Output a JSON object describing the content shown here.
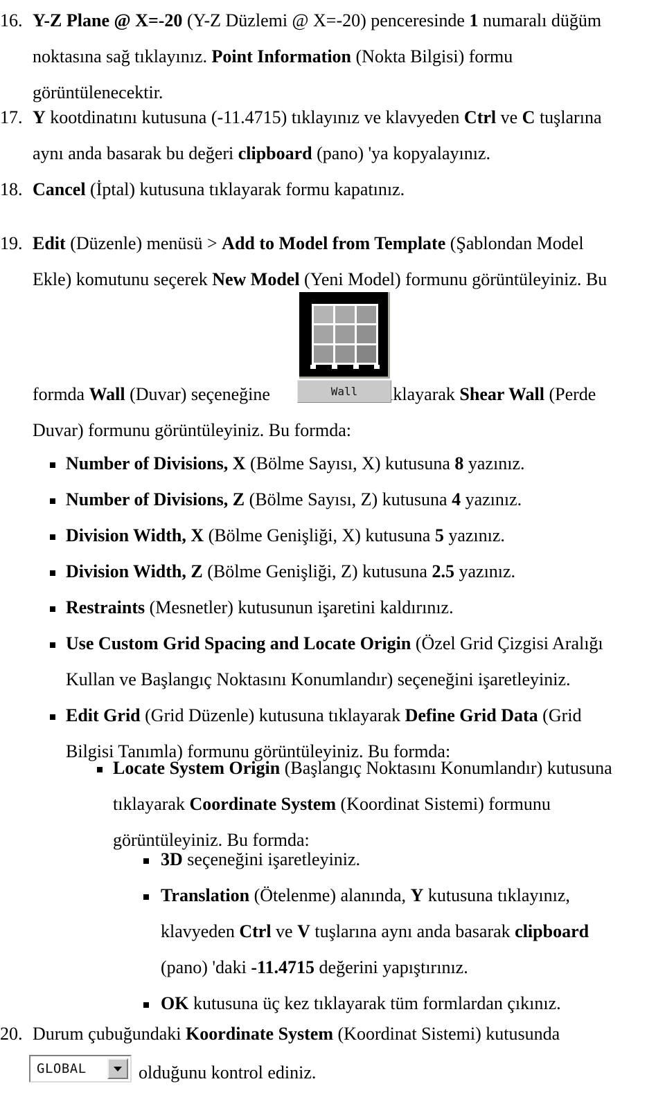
{
  "document": {
    "language": "Turkish",
    "steps": [
      {
        "number": "16.",
        "lines": [
          [
            {
              "t": "Y-Z Plane @ X=-20",
              "b": true
            },
            {
              "t": " (Y-Z Düzlemi @ X=-20) penceresinde ",
              "b": false
            },
            {
              "t": "1",
              "b": true
            },
            {
              "t": " numaralı düğüm",
              "b": false
            }
          ],
          [
            {
              "t": "noktasına sağ tıklayınız. ",
              "b": false
            },
            {
              "t": "Point Information",
              "b": true
            },
            {
              "t": " (Nokta Bilgisi) formu",
              "b": false
            }
          ],
          [
            {
              "t": "görüntülenecektir.",
              "b": false
            }
          ]
        ]
      },
      {
        "number": "17.",
        "lines": [
          [
            {
              "t": "Y",
              "b": true
            },
            {
              "t": " kootdinatını kutusuna (-11.4715) tıklayınız ve klavyeden ",
              "b": false
            },
            {
              "t": "Ctrl",
              "b": true
            },
            {
              "t": " ve ",
              "b": false
            },
            {
              "t": "C",
              "b": true
            },
            {
              "t": " tuşlarına",
              "b": false
            }
          ],
          [
            {
              "t": "aynı anda basarak bu değeri ",
              "b": false
            },
            {
              "t": "clipboard",
              "b": true
            },
            {
              "t": " (pano) 'ya kopyalayınız.",
              "b": false
            }
          ]
        ]
      },
      {
        "number": "18.",
        "lines": [
          [
            {
              "t": "Cancel",
              "b": true
            },
            {
              "t": " (İptal) kutusuna tıklayarak formu kapatınız.",
              "b": false
            }
          ]
        ]
      },
      {
        "number": "19.",
        "lines": [
          [
            {
              "t": "Edit",
              "b": true
            },
            {
              "t": " (Düzenle) menüsü > ",
              "b": false
            },
            {
              "t": "Add to Model from Template",
              "b": true
            },
            {
              "t": " (Şablondan Model",
              "b": false
            }
          ],
          [
            {
              "t": "Ekle) komutunu seçerek ",
              "b": false
            },
            {
              "t": "New Model",
              "b": true
            },
            {
              "t": " (Yeni Model) formunu görüntüleyiniz. Bu",
              "b": false
            }
          ]
        ]
      },
      {
        "number": "20.",
        "lines": [
          [
            {
              "t": "Durum çubuğundaki ",
              "b": false
            },
            {
              "t": "Koordinate System",
              "b": true
            },
            {
              "t": " (Koordinat Sistemi) kutusunda",
              "b": false
            }
          ]
        ]
      }
    ],
    "wall_para": {
      "before": [
        {
          "t": "formda ",
          "b": false
        },
        {
          "t": "Wall",
          "b": true
        },
        {
          "t": " (Duvar) seçeneğine",
          "b": false
        }
      ],
      "after": [
        {
          "t": "tıklayarak ",
          "b": false
        },
        {
          "t": "Shear Wall",
          "b": true
        },
        {
          "t": " (Perde",
          "b": false
        }
      ],
      "line2": [
        {
          "t": "Duvar) formunu görüntüleyiniz. Bu formda:",
          "b": false
        }
      ]
    },
    "bullets_level1": [
      {
        "lines": [
          [
            {
              "t": "Number of Divisions, X",
              "b": true
            },
            {
              "t": " (Bölme Sayısı, X) kutusuna ",
              "b": false
            },
            {
              "t": "8",
              "b": true
            },
            {
              "t": " yazınız.",
              "b": false
            }
          ]
        ]
      },
      {
        "lines": [
          [
            {
              "t": "Number of Divisions, Z",
              "b": true
            },
            {
              "t": " (Bölme Sayısı, Z) kutusuna ",
              "b": false
            },
            {
              "t": "4",
              "b": true
            },
            {
              "t": " yazınız.",
              "b": false
            }
          ]
        ]
      },
      {
        "lines": [
          [
            {
              "t": "Division Width, X",
              "b": true
            },
            {
              "t": " (Bölme Genişliği, X) kutusuna ",
              "b": false
            },
            {
              "t": "5",
              "b": true
            },
            {
              "t": " yazınız.",
              "b": false
            }
          ]
        ]
      },
      {
        "lines": [
          [
            {
              "t": "Division Width, Z",
              "b": true
            },
            {
              "t": " (Bölme Genişliği, Z) kutusuna ",
              "b": false
            },
            {
              "t": "2.5",
              "b": true
            },
            {
              "t": " yazınız.",
              "b": false
            }
          ]
        ]
      },
      {
        "lines": [
          [
            {
              "t": "Restraints",
              "b": true
            },
            {
              "t": " (Mesnetler) kutusunun işaretini kaldırınız.",
              "b": false
            }
          ]
        ]
      },
      {
        "lines": [
          [
            {
              "t": "Use Custom Grid Spacing and Locate Origin",
              "b": true
            },
            {
              "t": " (Özel Grid Çizgisi Aralığı",
              "b": false
            }
          ],
          [
            {
              "t": "Kullan ve Başlangıç Noktasını Konumlandır) seçeneğini işaretleyiniz.",
              "b": false
            }
          ]
        ]
      },
      {
        "lines": [
          [
            {
              "t": "Edit Grid",
              "b": true
            },
            {
              "t": " (Grid Düzenle) kutusuna tıklayarak ",
              "b": false
            },
            {
              "t": "Define Grid Data",
              "b": true
            },
            {
              "t": " (Grid",
              "b": false
            }
          ],
          [
            {
              "t": "Bilgisi Tanımla) formunu görüntüleyiniz. Bu formda:",
              "b": false
            }
          ]
        ]
      }
    ],
    "bullets_level2": [
      {
        "lines": [
          [
            {
              "t": "Locate System Origin",
              "b": true
            },
            {
              "t": " (Başlangıç Noktasını Konumlandır) kutusuna",
              "b": false
            }
          ],
          [
            {
              "t": "tıklayarak ",
              "b": false
            },
            {
              "t": "Coordinate System",
              "b": true
            },
            {
              "t": " (Koordinat Sistemi) formunu",
              "b": false
            }
          ],
          [
            {
              "t": "görüntüleyiniz. Bu formda:",
              "b": false
            }
          ]
        ]
      }
    ],
    "bullets_level3": [
      {
        "lines": [
          [
            {
              "t": "3D",
              "b": true
            },
            {
              "t": " seçeneğini işaretleyiniz.",
              "b": false
            }
          ]
        ]
      },
      {
        "lines": [
          [
            {
              "t": "Translation",
              "b": true
            },
            {
              "t": " (Ötelenme) alanında, ",
              "b": false
            },
            {
              "t": "Y",
              "b": true
            },
            {
              "t": " kutusuna tıklayınız,",
              "b": false
            }
          ],
          [
            {
              "t": "klavyeden ",
              "b": false
            },
            {
              "t": "Ctrl",
              "b": true
            },
            {
              "t": " ve ",
              "b": false
            },
            {
              "t": "V",
              "b": true
            },
            {
              "t": " tuşlarına aynı anda basarak ",
              "b": false
            },
            {
              "t": "clipboard",
              "b": true
            }
          ],
          [
            {
              "t": "(pano) 'daki ",
              "b": false
            },
            {
              "t": "-11.4715",
              "b": true
            },
            {
              "t": " değerini yapıştırınız.",
              "b": false
            }
          ]
        ]
      },
      {
        "lines": [
          [
            {
              "t": "OK",
              "b": true
            },
            {
              "t": " kutusuna üç kez tıklayarak tüm formlardan çıkınız.",
              "b": false
            }
          ]
        ]
      }
    ],
    "final_line": [
      {
        "t": "olduğunu kontrol ediniz.",
        "b": false
      }
    ],
    "widgets": {
      "wall_button": {
        "label": "Wall",
        "grid_rows": 3,
        "grid_cols": 3,
        "background": "#000000",
        "label_background": "#c9c9c9"
      },
      "coordinate_system_combo": {
        "value": "GLOBAL",
        "arrow": "chevron-down"
      }
    }
  }
}
